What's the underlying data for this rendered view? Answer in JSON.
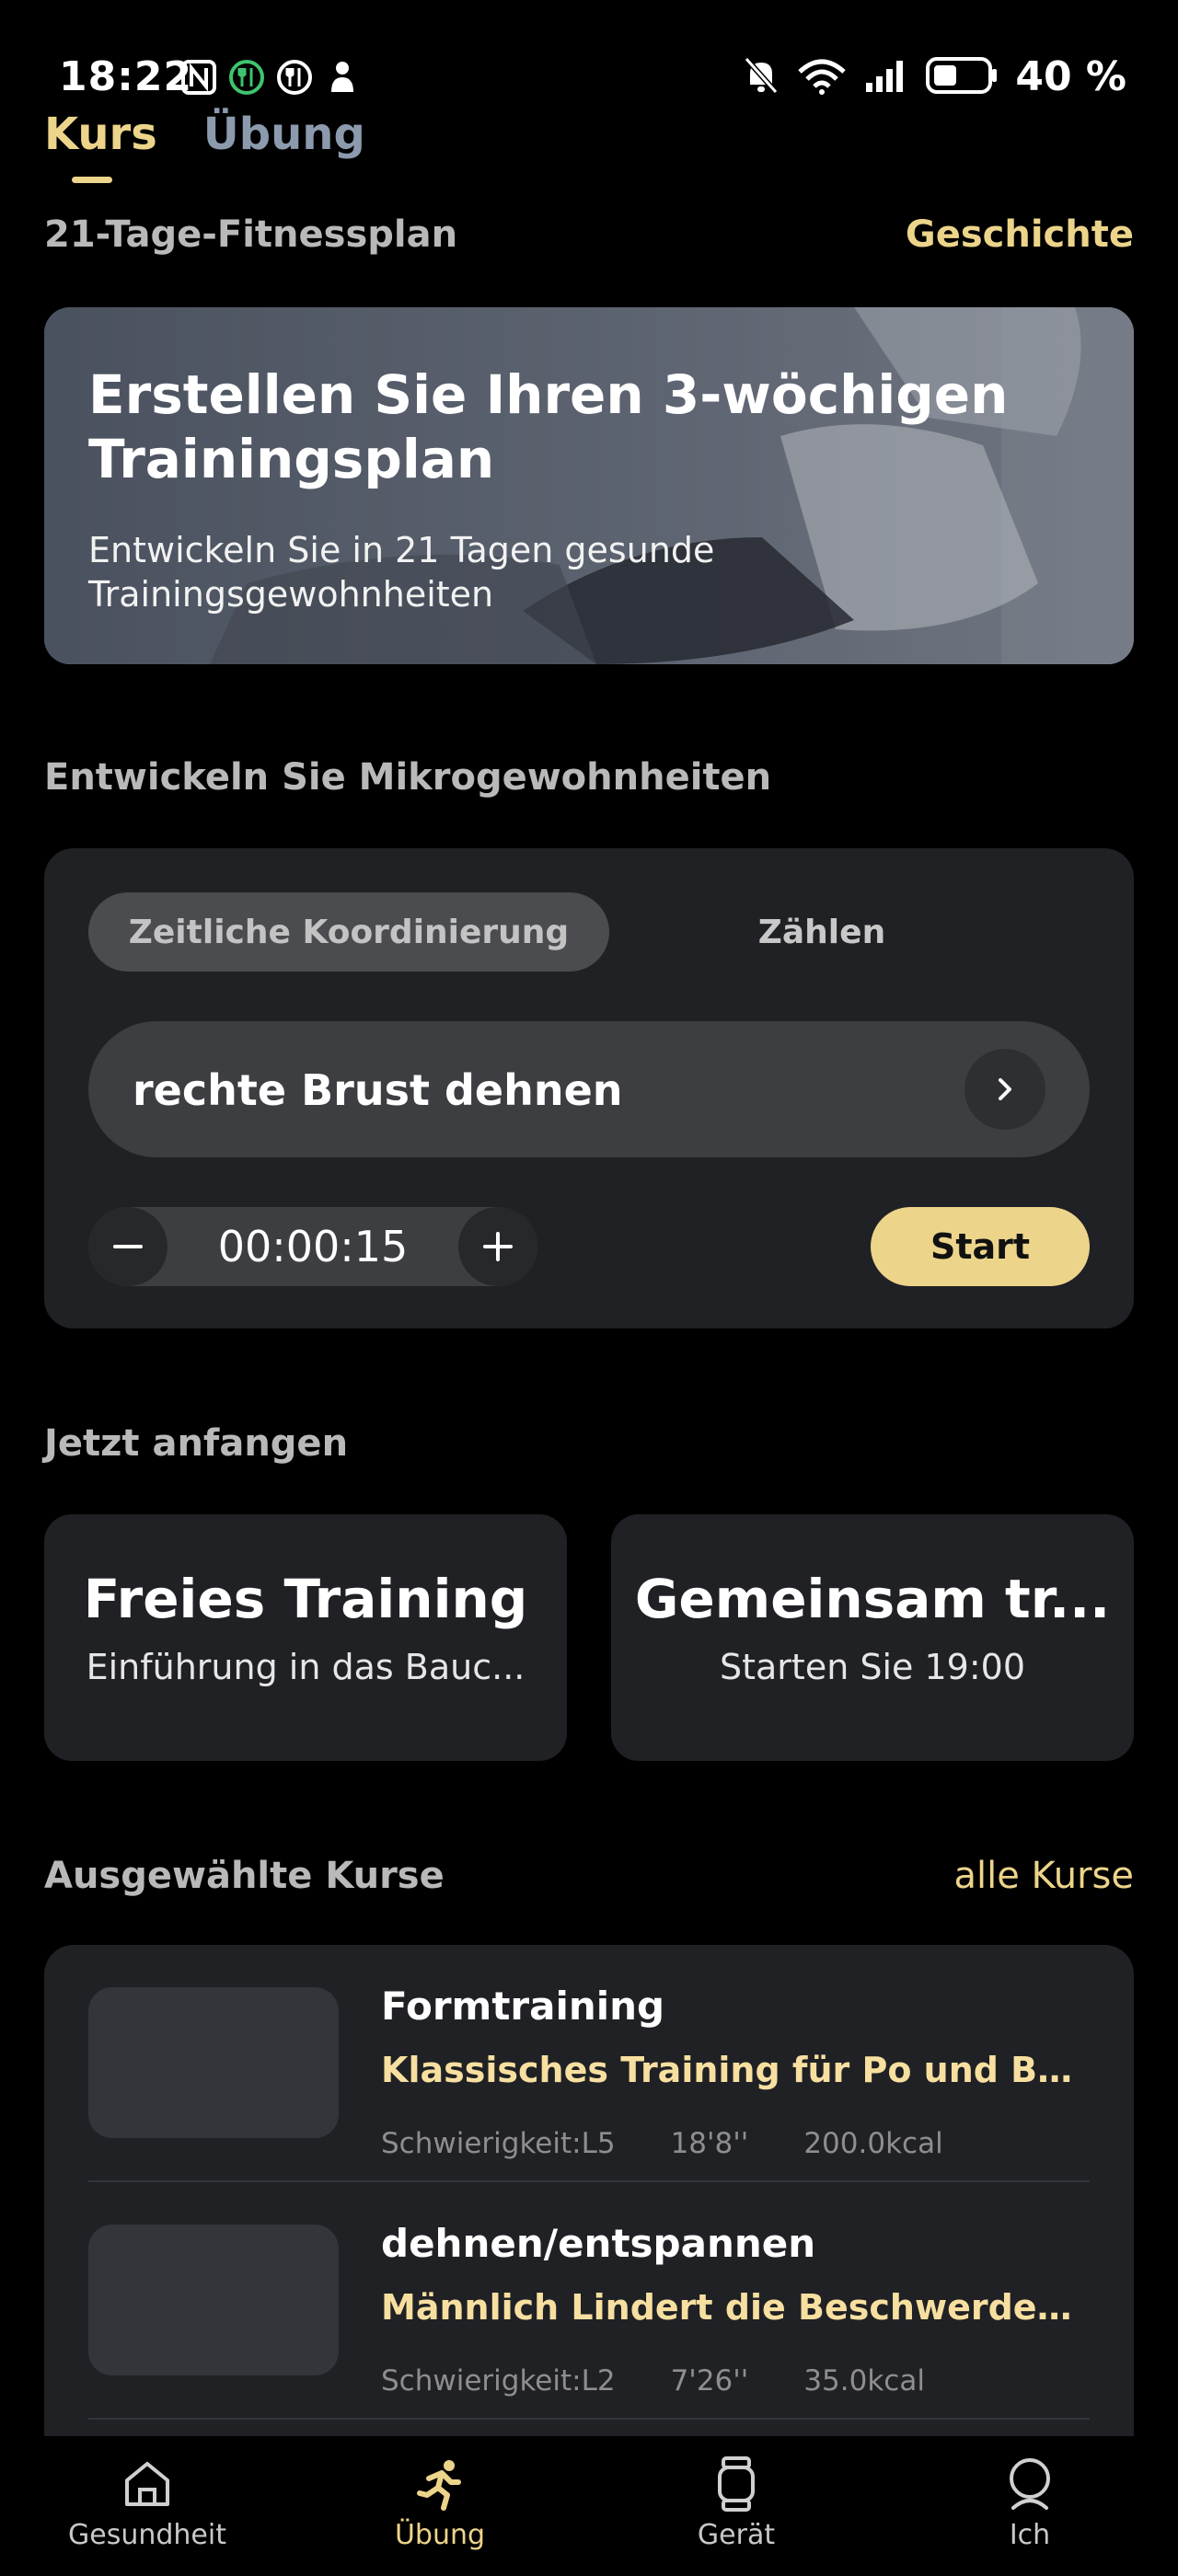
{
  "status_bar": {
    "time": "18:22",
    "battery_text": "40 %",
    "left_icons": [
      "nfc-icon",
      "fork-knife-active-icon",
      "fork-knife-icon",
      "baby-icon"
    ],
    "right_icons": [
      "mute-bell-icon",
      "wifi-6-icon",
      "signal-icon",
      "battery-icon"
    ]
  },
  "top_tabs": [
    {
      "label": "Kurs",
      "active": true
    },
    {
      "label": "Übung",
      "active": false
    }
  ],
  "plan": {
    "title": "21-Tage-Fitnessplan",
    "history": "Geschichte"
  },
  "banner": {
    "title": "Erstellen Sie Ihren 3-wöchigen Trainingsplan",
    "subtitle": "Entwickeln Sie in 21 Tagen gesunde Trainingsgewohnheiten"
  },
  "micro_habits": {
    "section_title": "Entwickeln Sie Mikrogewohnheiten",
    "segments": [
      "Zeitliche Koordinierung",
      "Zählen"
    ],
    "selected_segment": "Zeitliche Koordinierung",
    "exercise": "rechte Brust dehnen",
    "duration": "00:00:15",
    "start_label": "Start"
  },
  "start_now": {
    "section_title": "Jetzt anfangen",
    "cards": [
      {
        "title": "Freies Training",
        "subtitle": "Einführung in das Bauc..."
      },
      {
        "title": "Gemeinsam tr...",
        "subtitle": "Starten Sie 19:00"
      }
    ]
  },
  "featured": {
    "section_title": "Ausgewählte Kurse",
    "all_label": "alle Kurse",
    "courses": [
      {
        "name": "Formtraining",
        "desc": "Klassisches Training für Po und Bei...",
        "difficulty": "Schwierigkeit:L5",
        "duration": "18'8''",
        "kcal": "200.0kcal"
      },
      {
        "name": "dehnen/entspannen",
        "desc": "Männlich Lindert die Beschwerden ...",
        "difficulty": "Schwierigkeit:L2",
        "duration": "7'26''",
        "kcal": "35.0kcal"
      }
    ]
  },
  "bottom_nav": [
    {
      "label": "Gesundheit",
      "icon": "home-heart-icon",
      "active": false
    },
    {
      "label": "Übung",
      "icon": "running-icon",
      "active": true
    },
    {
      "label": "Gerät",
      "icon": "watch-icon",
      "active": false
    },
    {
      "label": "Ich",
      "icon": "user-icon",
      "active": false
    }
  ],
  "colors": {
    "accent": "#ecd48a",
    "background": "#000000",
    "card": "#202125"
  }
}
